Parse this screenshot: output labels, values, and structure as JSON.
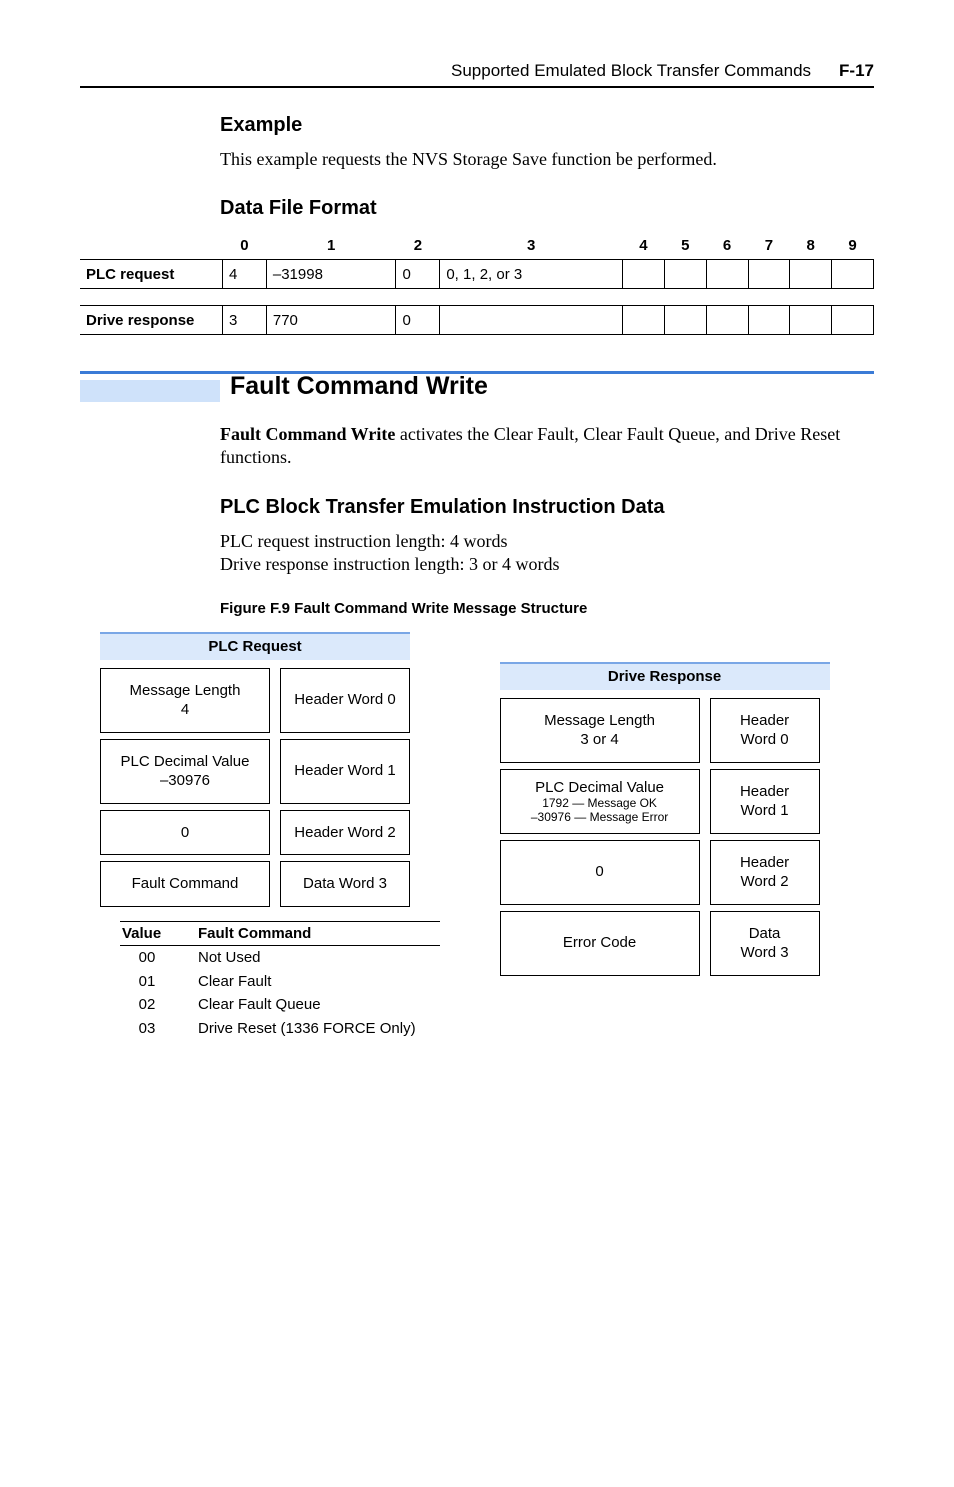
{
  "header": {
    "title": "Supported Emulated Block Transfer Commands",
    "page": "F-17"
  },
  "example": {
    "heading": "Example",
    "text": "This example requests the NVS Storage Save function be performed."
  },
  "data_file_format": {
    "heading": "Data File Format",
    "cols": [
      "0",
      "1",
      "2",
      "3",
      "4",
      "5",
      "6",
      "7",
      "8",
      "9"
    ],
    "plc_label": "PLC request",
    "drive_label": "Drive response",
    "plc_row": [
      "4",
      "–31998",
      "0",
      "0, 1, 2, or 3",
      "",
      "",
      "",
      "",
      "",
      ""
    ],
    "drive_row": [
      "3",
      "770",
      "0",
      "",
      "",
      "",
      "",
      "",
      "",
      ""
    ]
  },
  "fault_command_write": {
    "title": "Fault Command Write",
    "para": "Fault Command Write activates the Clear Fault, Clear Fault Queue, and Drive Reset functions.",
    "bold_lead": "Fault Command Write"
  },
  "plc_block": {
    "heading": "PLC Block Transfer Emulation Instruction Data",
    "line1": "PLC request instruction length: 4 words",
    "line2": "Drive response instruction length: 3 or 4 words"
  },
  "figure": {
    "caption": "Figure F.9   Fault Command Write Message Structure"
  },
  "plc_request": {
    "title": "PLC Request",
    "rows": [
      {
        "left_line1": "Message Length",
        "left_line2": "4",
        "right": "Header Word 0"
      },
      {
        "left_line1": "PLC Decimal Value",
        "left_line2": "–30976",
        "right": "Header Word 1"
      },
      {
        "left_line1": "0",
        "left_line2": "",
        "right": "Header Word 2"
      },
      {
        "left_line1": "Fault Command",
        "left_line2": "",
        "right": "Data Word 3"
      }
    ]
  },
  "drive_response": {
    "title": "Drive Response",
    "rows": [
      {
        "left_line1": "Message Length",
        "left_line2": "3 or 4",
        "right_line1": "Header",
        "right_line2": "Word 0"
      },
      {
        "left_line1": "PLC Decimal Value",
        "left_sub1": "1792 — Message OK",
        "left_sub2": "–30976 — Message Error",
        "right_line1": "Header",
        "right_line2": "Word 1"
      },
      {
        "left_line1": "0",
        "right_line1": "Header",
        "right_line2": "Word 2"
      },
      {
        "left_line1": "Error Code",
        "right_line1": "Data",
        "right_line2": "Word 3"
      }
    ]
  },
  "fault_table": {
    "h1": "Value",
    "h2": "Fault Command",
    "rows": [
      {
        "v": "00",
        "d": "Not Used"
      },
      {
        "v": "01",
        "d": "Clear Fault"
      },
      {
        "v": "02",
        "d": "Clear Fault Queue"
      },
      {
        "v": "03",
        "d": "Drive Reset (1336 FORCE Only)"
      }
    ]
  }
}
